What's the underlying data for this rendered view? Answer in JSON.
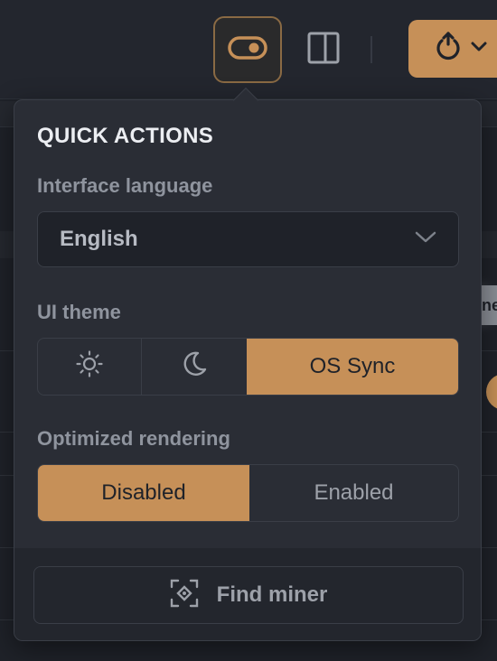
{
  "popover": {
    "title": "QUICK ACTIONS",
    "language": {
      "label": "Interface language",
      "selected": "English"
    },
    "theme": {
      "label": "UI theme",
      "options": [
        {
          "icon": "sun-icon",
          "label": ""
        },
        {
          "icon": "moon-icon",
          "label": ""
        },
        {
          "icon": "",
          "label": "OS Sync"
        }
      ],
      "selected_index": 2
    },
    "rendering": {
      "label": "Optimized rendering",
      "options": [
        "Disabled",
        "Enabled"
      ],
      "selected_index": 0
    },
    "find_miner_label": "Find miner"
  },
  "background": {
    "partial_tag": "ne"
  },
  "colors": {
    "accent": "#c69058",
    "panel": "#2a2d35",
    "page_bg": "#1f2229",
    "text_muted": "#8f949e"
  }
}
